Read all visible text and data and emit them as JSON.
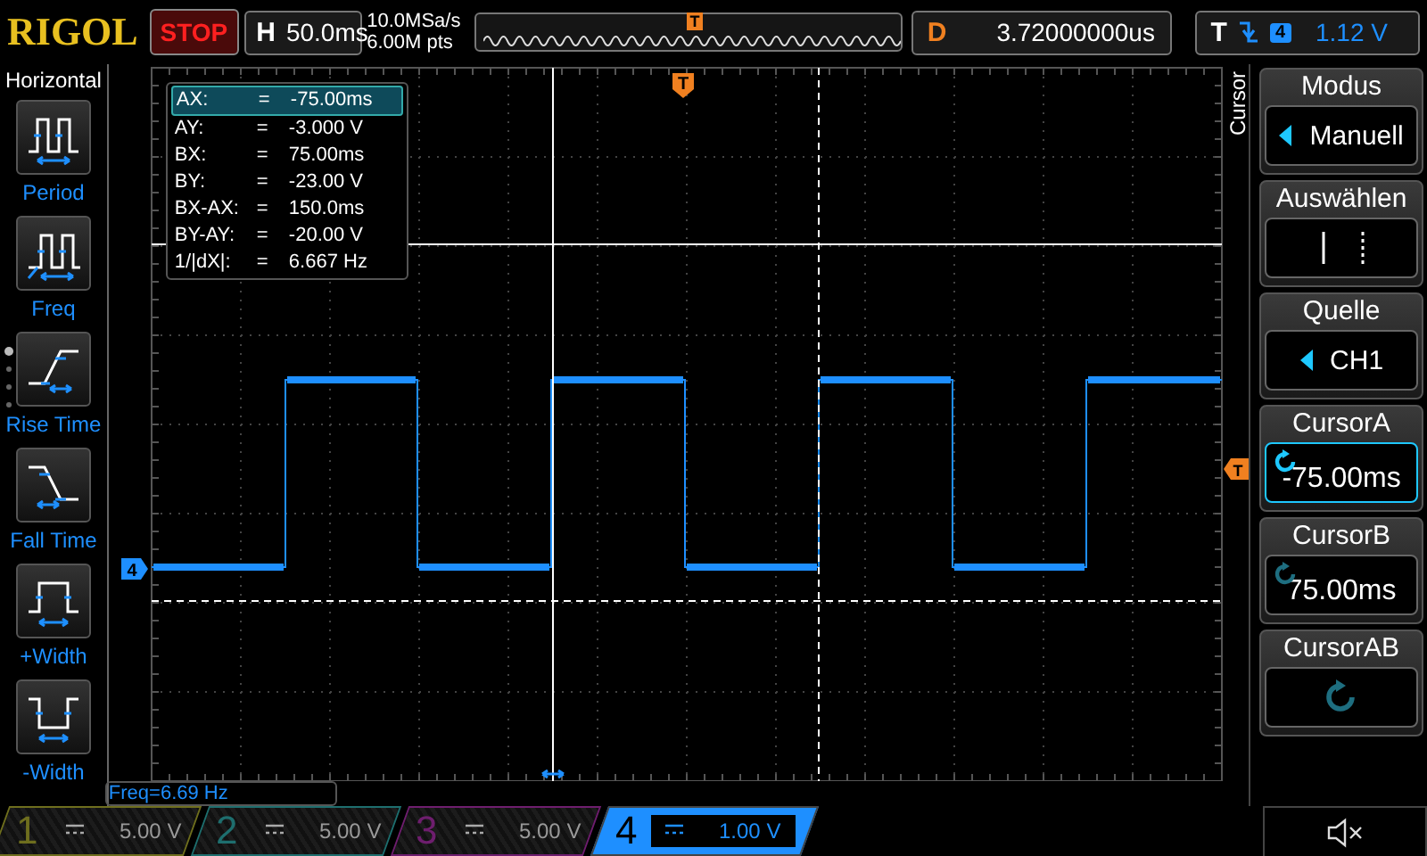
{
  "top_bar": {
    "logo": "RIGOL",
    "run_state": "STOP",
    "timebase_label": "H",
    "timebase": "50.0ms",
    "sample_rate": "10.0MSa/s",
    "memory_depth": "6.00M pts",
    "overview_marker": "T",
    "delay_label": "D",
    "delay": "3.72000000us",
    "trigger_label": "T",
    "trigger_source": "4",
    "trigger_level": "1.12 V"
  },
  "left_menu": {
    "title": "Horizontal",
    "items": [
      {
        "label": "Period",
        "kind": "period"
      },
      {
        "label": "Freq",
        "kind": "freq"
      },
      {
        "label": "Rise Time",
        "kind": "rise"
      },
      {
        "label": "Fall Time",
        "kind": "fall"
      },
      {
        "label": "+Width",
        "kind": "pos_width"
      },
      {
        "label": "-Width",
        "kind": "neg_width"
      }
    ]
  },
  "cursor_readout": [
    {
      "name": "AX:",
      "equals": "=",
      "value": "-75.00ms",
      "selected": true
    },
    {
      "name": "AY:",
      "equals": "=",
      "value": "-3.000 V",
      "selected": false
    },
    {
      "name": "BX:",
      "equals": "=",
      "value": "75.00ms",
      "selected": false
    },
    {
      "name": "BY:",
      "equals": "=",
      "value": "-23.00 V",
      "selected": false
    },
    {
      "name": "BX-AX:",
      "equals": "=",
      "value": "150.0ms",
      "selected": false
    },
    {
      "name": "BY-AY:",
      "equals": "=",
      "value": "-20.00 V",
      "selected": false
    },
    {
      "name": "1/|dX|:",
      "equals": "=",
      "value": "6.667 Hz",
      "selected": false
    }
  ],
  "screen": {
    "trigger_marker": "T",
    "trigger_level_marker": "T",
    "channel_marker": "4",
    "measurement": "Freq=6.69 Hz"
  },
  "right_menu": {
    "title": "Cursor",
    "items": [
      {
        "label": "Modus",
        "kind": "choice",
        "value": "Manuell",
        "selected": false
      },
      {
        "label": "Auswählen",
        "kind": "select",
        "selected": false
      },
      {
        "label": "Quelle",
        "kind": "choice",
        "value": "CH1",
        "selected": false
      },
      {
        "label": "CursorA",
        "kind": "value",
        "value": "-75.00ms",
        "selected": true
      },
      {
        "label": "CursorB",
        "kind": "value",
        "value": "75.00ms",
        "selected": false
      },
      {
        "label": "CursorAB",
        "kind": "action",
        "selected": false
      }
    ]
  },
  "channels": [
    {
      "number": "1",
      "scale": "5.00 V",
      "color": "#6e6e1e",
      "selected": false
    },
    {
      "number": "2",
      "scale": "5.00 V",
      "color": "#1e6e6e",
      "selected": false
    },
    {
      "number": "3",
      "scale": "5.00 V",
      "color": "#6e1e6e",
      "selected": false
    },
    {
      "number": "4",
      "scale": "1.00 V",
      "color": "#1e8fff",
      "selected": true
    }
  ]
}
